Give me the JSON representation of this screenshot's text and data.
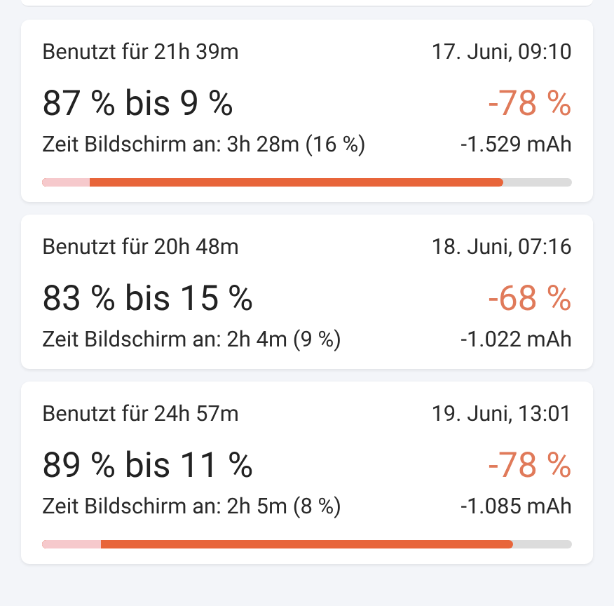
{
  "sessions": [
    {
      "used_for": "Benutzt für 21h 39m",
      "date": "17. Juni, 09:10",
      "range": "87 % bis 9 %",
      "drop": "-78 %",
      "screen_on": "Zeit Bildschirm an: 3h 28m (16 %)",
      "mah": "-1.529 mAh",
      "bar": [
        {
          "kind": "start",
          "level": 0.87
        },
        {
          "kind": "end",
          "level": 0.09
        }
      ]
    },
    {
      "used_for": "Benutzt für 20h 48m",
      "date": "18. Juni, 07:16",
      "range": "83 % bis 15 %",
      "drop": "-68 %",
      "screen_on": "Zeit Bildschirm an: 2h 4m (9 %)",
      "mah": "-1.022 mAh"
    },
    {
      "used_for": "Benutzt für 24h 57m",
      "date": "19. Juni, 13:01",
      "range": "89 % bis 11 %",
      "drop": "-78 %",
      "screen_on": "Zeit Bildschirm an: 2h 5m (8 %)",
      "mah": "-1.085 mAh",
      "bar": [
        {
          "kind": "start",
          "level": 0.89
        },
        {
          "kind": "end",
          "level": 0.11
        }
      ]
    }
  ]
}
